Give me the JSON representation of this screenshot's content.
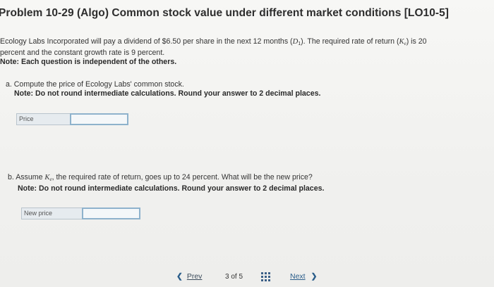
{
  "problem": {
    "title": "Problem 10-29 (Algo) Common stock value under different market conditions [LO10-5]"
  },
  "intro": {
    "line1_a": "Ecology Labs Incorporated will pay a dividend of $6.50 per share in the next 12 months (",
    "d_symbol": "D",
    "d_sub": "1",
    "line1_b": "). The required rate of return (",
    "k_symbol": "K",
    "k_sub": "e",
    "line1_c": ") is 20",
    "line2": "percent and the constant growth rate is 9 percent.",
    "note": "Note: Each question is independent of the others."
  },
  "part_a": {
    "question": "a. Compute the price of Ecology Labs' common stock.",
    "note": "Note: Do not round intermediate calculations. Round your answer to 2 decimal places.",
    "answer_label": "Price",
    "answer_value": ""
  },
  "part_b": {
    "question_a": "b. Assume ",
    "k_symbol": "K",
    "k_sub": "e",
    "question_b": ", the required rate of return, goes up to 24 percent. What will be the new price?",
    "note": "Note: Do not round intermediate calculations. Round your answer to 2 decimal places.",
    "answer_label": "New price",
    "answer_value": ""
  },
  "navigation": {
    "prev_label": "Prev",
    "page_current": "3",
    "page_of": "of",
    "page_total": "5",
    "next_label": "Next",
    "prev_icon": "chevron-left-icon",
    "next_icon": "chevron-right-icon",
    "grid_icon": "grid-icon",
    "accent_color": "#2a5d8a"
  }
}
